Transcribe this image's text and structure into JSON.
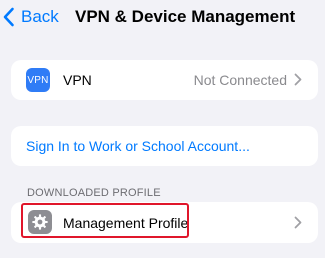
{
  "nav": {
    "back_label": "Back",
    "title": "VPN & Device Management"
  },
  "vpn_row": {
    "icon_text": "VPN",
    "label": "VPN",
    "status": "Not Connected"
  },
  "sign_in_row": {
    "label": "Sign In to Work or School Account..."
  },
  "downloaded_section": {
    "header": "DOWNLOADED PROFILE",
    "profile_label": "Management Profile"
  },
  "colors": {
    "accent": "#007aff",
    "highlight": "#e0162b",
    "vpn_icon": "#2f7cf6",
    "gear_icon": "#8e8e93",
    "background": "#f2f2f7"
  }
}
